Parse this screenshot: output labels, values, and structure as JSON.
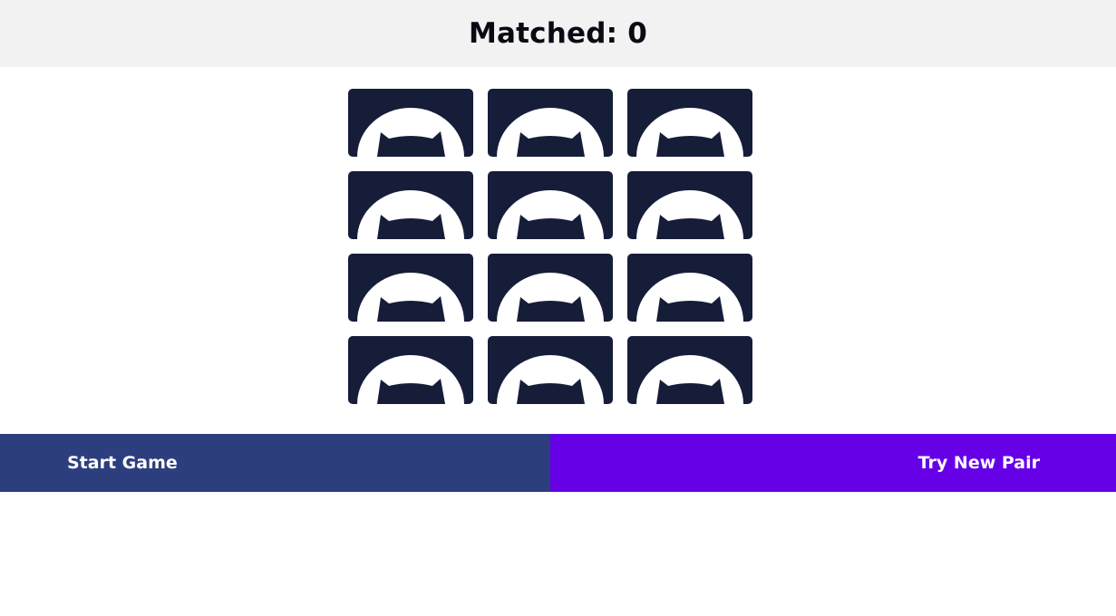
{
  "header": {
    "score_label": "Matched: 0"
  },
  "board": {
    "rows": 4,
    "columns": 3,
    "card_back_icon": "cat-silhouette-icon",
    "card_color": "#161d39",
    "cards": [
      {
        "state": "face-down"
      },
      {
        "state": "face-down"
      },
      {
        "state": "face-down"
      },
      {
        "state": "face-down"
      },
      {
        "state": "face-down"
      },
      {
        "state": "face-down"
      },
      {
        "state": "face-down"
      },
      {
        "state": "face-down"
      },
      {
        "state": "face-down"
      },
      {
        "state": "face-down"
      },
      {
        "state": "face-down"
      },
      {
        "state": "face-down"
      }
    ]
  },
  "controls": {
    "start_label": "Start Game",
    "try_label": "Try New Pair",
    "start_color": "#2c3e7e",
    "try_color": "#6600e6"
  }
}
